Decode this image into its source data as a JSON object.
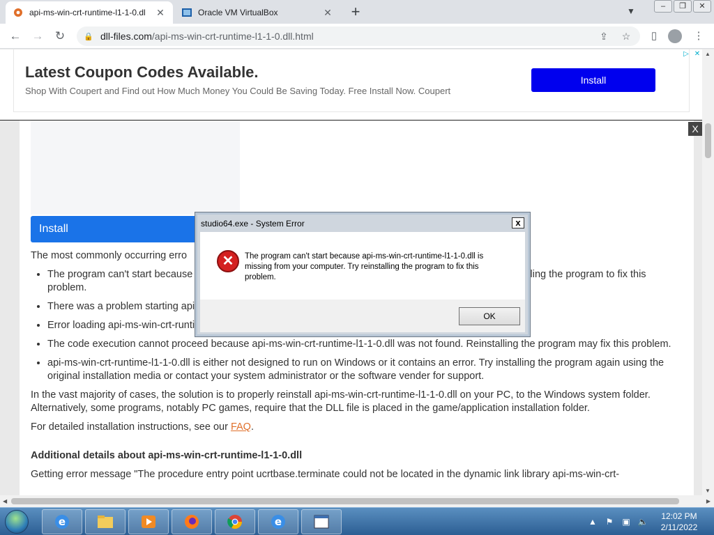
{
  "browser": {
    "tabs": [
      {
        "title": "api-ms-win-crt-runtime-l1-1-0.dl",
        "active": true
      },
      {
        "title": "Oracle VM VirtualBox",
        "active": false
      }
    ],
    "new_tab_label": "+",
    "url_host": "dll-files.com",
    "url_path": "/api-ms-win-crt-runtime-l1-1-0.dll.html"
  },
  "ad": {
    "title": "Latest Coupon Codes Available.",
    "subtitle": "Shop With Coupert and Find out How Much Money You Could Be Saving Today. Free Install Now. Coupert",
    "button": "Install",
    "close": "X"
  },
  "page": {
    "install_button": "Install",
    "intro": "The most commonly occurring erro",
    "bullets": [
      "The program can't start because api-ms-win-crt-runtime-l1-1-0.dll is missing from your computer. Try reinstalling the program to fix this problem.",
      "There was a problem starting api-ms-win-crt-runtime-l1-1-0.dll. The specified module could not be found.",
      "Error loading api-ms-win-crt-runtime-l1-1-0.dll. The specified module could not be found.",
      "The code execution cannot proceed because api-ms-win-crt-runtime-l1-1-0.dll was not found. Reinstalling the program may fix this problem.",
      "api-ms-win-crt-runtime-l1-1-0.dll is either not designed to run on Windows or it contains an error. Try installing the program again using the original installation media or contact your system administrator or the software vender for support."
    ],
    "solution": "In the vast majority of cases, the solution is to properly reinstall api-ms-win-crt-runtime-l1-1-0.dll on your PC, to the Windows system folder. Alternatively, some programs, notably PC games, require that the DLL file is placed in the game/application installation folder.",
    "instructions_prefix": "For detailed installation instructions, see our ",
    "faq_link": "FAQ",
    "instructions_suffix": ".",
    "details_heading": "Additional details about api-ms-win-crt-runtime-l1-1-0.dll",
    "details_text": "Getting error message \"The procedure entry point ucrtbase.terminate could not be located in the dynamic link library api-ms-win-crt-"
  },
  "dialog": {
    "title": "studio64.exe - System Error",
    "close": "x",
    "message": "The program can't start because api-ms-win-crt-runtime-l1-1-0.dll is missing from your computer. Try reinstalling the program to fix this problem.",
    "ok": "OK"
  },
  "taskbar": {
    "time": "12:02 PM",
    "date": "2/11/2022",
    "apps": [
      "internet-explorer",
      "file-explorer",
      "media-player",
      "firefox",
      "chrome",
      "internet-explorer",
      "virtualbox"
    ]
  }
}
